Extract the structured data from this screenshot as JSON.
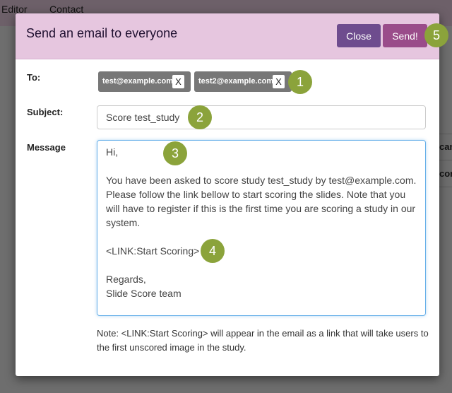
{
  "nav": {
    "items": [
      "Editor",
      "Contact"
    ]
  },
  "background": {
    "fragments": [
      "can",
      "core"
    ]
  },
  "modal": {
    "title": "Send an email to everyone",
    "close_label": "Close",
    "send_label": "Send!",
    "to_label": "To:",
    "recipients": [
      {
        "email": "test@example.com",
        "remove": "X"
      },
      {
        "email": "test2@example.com",
        "remove": "X"
      }
    ],
    "subject_label": "Subject:",
    "subject_value": "Score test_study",
    "message_label": "Message",
    "message_value": "Hi,\n\nYou have been asked to score study test_study by test@example.com.\nPlease follow the link bellow to start scoring the slides. Note that you will have to register if this is the first time you are scoring a study in our system.\n\n<LINK:Start Scoring>\n\nRegards,\nSlide Score team",
    "note": "Note: <LINK:Start Scoring> will appear in the email as a link that will take users to the first unscored image in the study."
  },
  "annotations": [
    "1",
    "2",
    "3",
    "4",
    "5"
  ],
  "colors": {
    "badge": "#8ba33b",
    "close": "#6e4c8e",
    "send": "#9a4c8a",
    "header": "#e6c6df"
  }
}
